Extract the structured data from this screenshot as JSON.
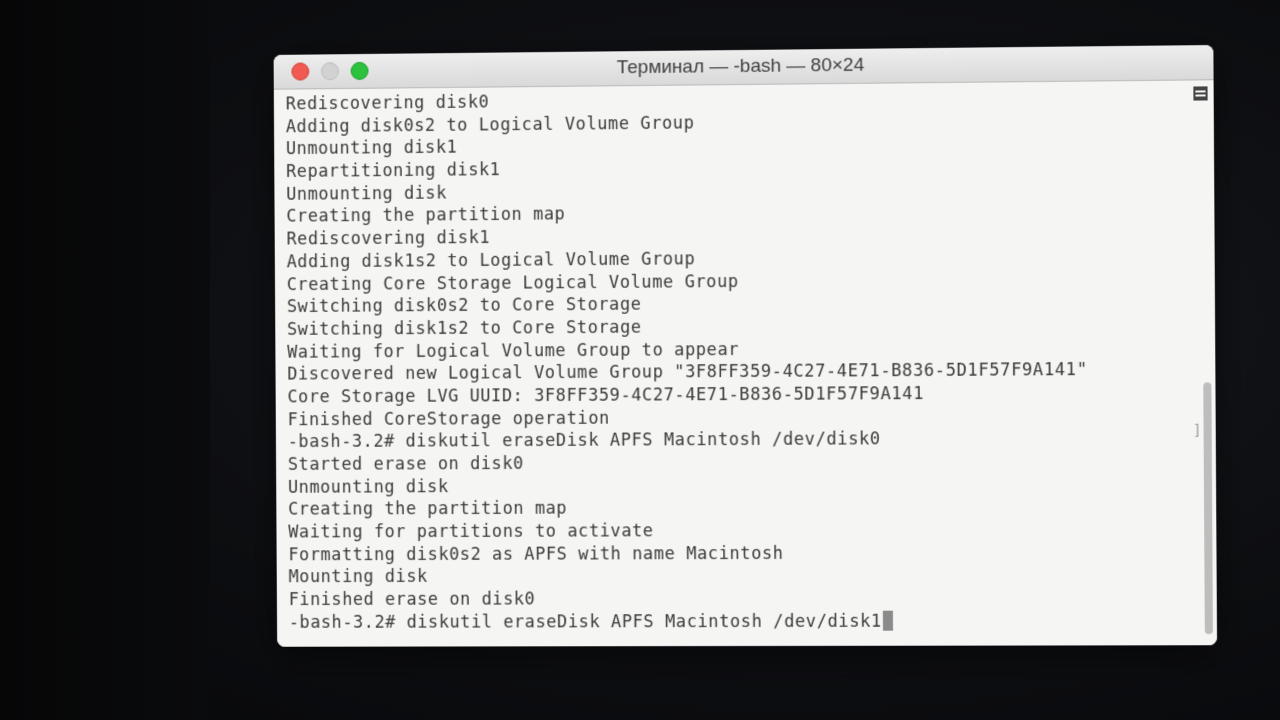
{
  "window": {
    "title": "Терминал — -bash — 80×24"
  },
  "terminal": {
    "lines": [
      "Rediscovering disk0",
      "Adding disk0s2 to Logical Volume Group",
      "Unmounting disk1",
      "Repartitioning disk1",
      "Unmounting disk",
      "Creating the partition map",
      "Rediscovering disk1",
      "Adding disk1s2 to Logical Volume Group",
      "Creating Core Storage Logical Volume Group",
      "Switching disk0s2 to Core Storage",
      "Switching disk1s2 to Core Storage",
      "Waiting for Logical Volume Group to appear",
      "Discovered new Logical Volume Group \"3F8FF359-4C27-4E71-B836-5D1F57F9A141\"",
      "Core Storage LVG UUID: 3F8FF359-4C27-4E71-B836-5D1F57F9A141",
      "Finished CoreStorage operation",
      "-bash-3.2# diskutil eraseDisk APFS Macintosh /dev/disk0",
      "Started erase on disk0",
      "Unmounting disk",
      "Creating the partition map",
      "Waiting for partitions to activate",
      "Formatting disk0s2 as APFS with name Macintosh",
      "Mounting disk",
      "Finished erase on disk0",
      "-bash-3.2# diskutil eraseDisk APFS Macintosh /dev/disk1"
    ],
    "bracket_mark": "]"
  },
  "icons": {
    "close": "close-button",
    "minimize": "minimize-button",
    "zoom": "zoom-button",
    "marker": "mark-icon"
  },
  "colors": {
    "close": "#f05a52",
    "minimize": "#d2d2d2",
    "zoom": "#2cc23e",
    "terminal_bg": "#f5f5f3",
    "terminal_text": "#3a3a3a"
  }
}
